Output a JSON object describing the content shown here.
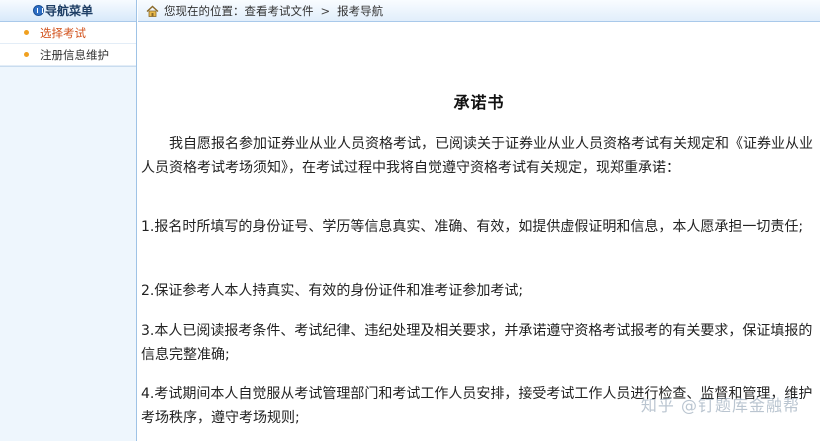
{
  "sidebar": {
    "header_title": "导航菜单",
    "items": [
      {
        "label": "选择考试",
        "active": true
      },
      {
        "label": "注册信息维护",
        "active": false
      }
    ]
  },
  "breadcrumb": {
    "prefix": "您现在的位置：",
    "items": [
      "查看考试文件",
      "报考导航"
    ],
    "separator": ">"
  },
  "document": {
    "title": "承诺书",
    "intro": "我自愿报名参加证券业从业人员资格考试，已阅读关于证券业从业人员资格考试有关规定和《证券业从业人员资格考试考场须知》，在考试过程中我将自觉遵守资格考试有关规定，现郑重承诺：",
    "items": [
      "1.报名时所填写的身份证号、学历等信息真实、准确、有效，如提供虚假证明和信息，本人愿承担一切责任;",
      "2.保证参考人本人持真实、有效的身份证件和准考证参加考试;",
      "3.本人已阅读报考条件、考试纪律、违纪处理及相关要求，并承诺遵守资格考试报考的有关要求，保证填报的信息完整准确;",
      "4.考试期间本人自觉服从考试管理部门和考试工作人员安排，接受考试工作人员进行检查、监督和管理，维护考场秩序，遵守考场规则;"
    ]
  },
  "watermark": "知乎 @钉题库金融帮",
  "colors": {
    "sidebar_bg": "#eef6fd",
    "active_item": "#d2521c",
    "bullet": "#f0a020",
    "border": "#9fc3e6"
  }
}
